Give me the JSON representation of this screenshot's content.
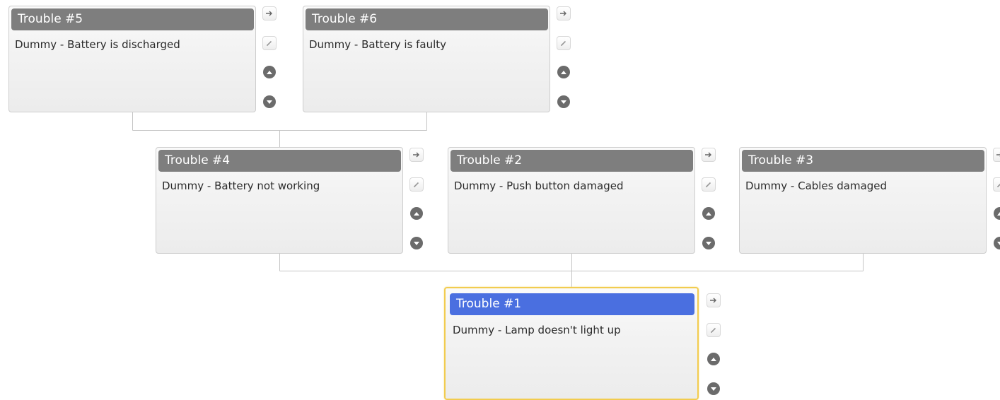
{
  "nodes": [
    {
      "id": "trouble-5",
      "title": "Trouble #5",
      "description": "Dummy - Battery is discharged",
      "selected": false
    },
    {
      "id": "trouble-6",
      "title": "Trouble #6",
      "description": "Dummy - Battery is faulty",
      "selected": false
    },
    {
      "id": "trouble-4",
      "title": "Trouble #4",
      "description": "Dummy - Battery not working",
      "selected": false
    },
    {
      "id": "trouble-2",
      "title": "Trouble #2",
      "description": "Dummy - Push button damaged",
      "selected": false
    },
    {
      "id": "trouble-3",
      "title": "Trouble #3",
      "description": "Dummy - Cables damaged",
      "selected": false
    },
    {
      "id": "trouble-1",
      "title": "Trouble #1",
      "description": "Dummy - Lamp doesn't light up",
      "selected": true
    }
  ],
  "edges": [
    {
      "from": "trouble-5",
      "to": "trouble-4"
    },
    {
      "from": "trouble-6",
      "to": "trouble-4"
    },
    {
      "from": "trouble-4",
      "to": "trouble-1"
    },
    {
      "from": "trouble-2",
      "to": "trouble-1"
    },
    {
      "from": "trouble-3",
      "to": "trouble-1"
    }
  ],
  "node_tools": [
    "arrow-right-icon",
    "pencil-icon",
    "move-up-icon",
    "move-down-icon"
  ],
  "colors": {
    "title_bar": "#7e7e7e",
    "title_bar_selected": "#4a6fe0",
    "selected_border": "#f2cc4f",
    "connector": "#c4c4c4"
  }
}
